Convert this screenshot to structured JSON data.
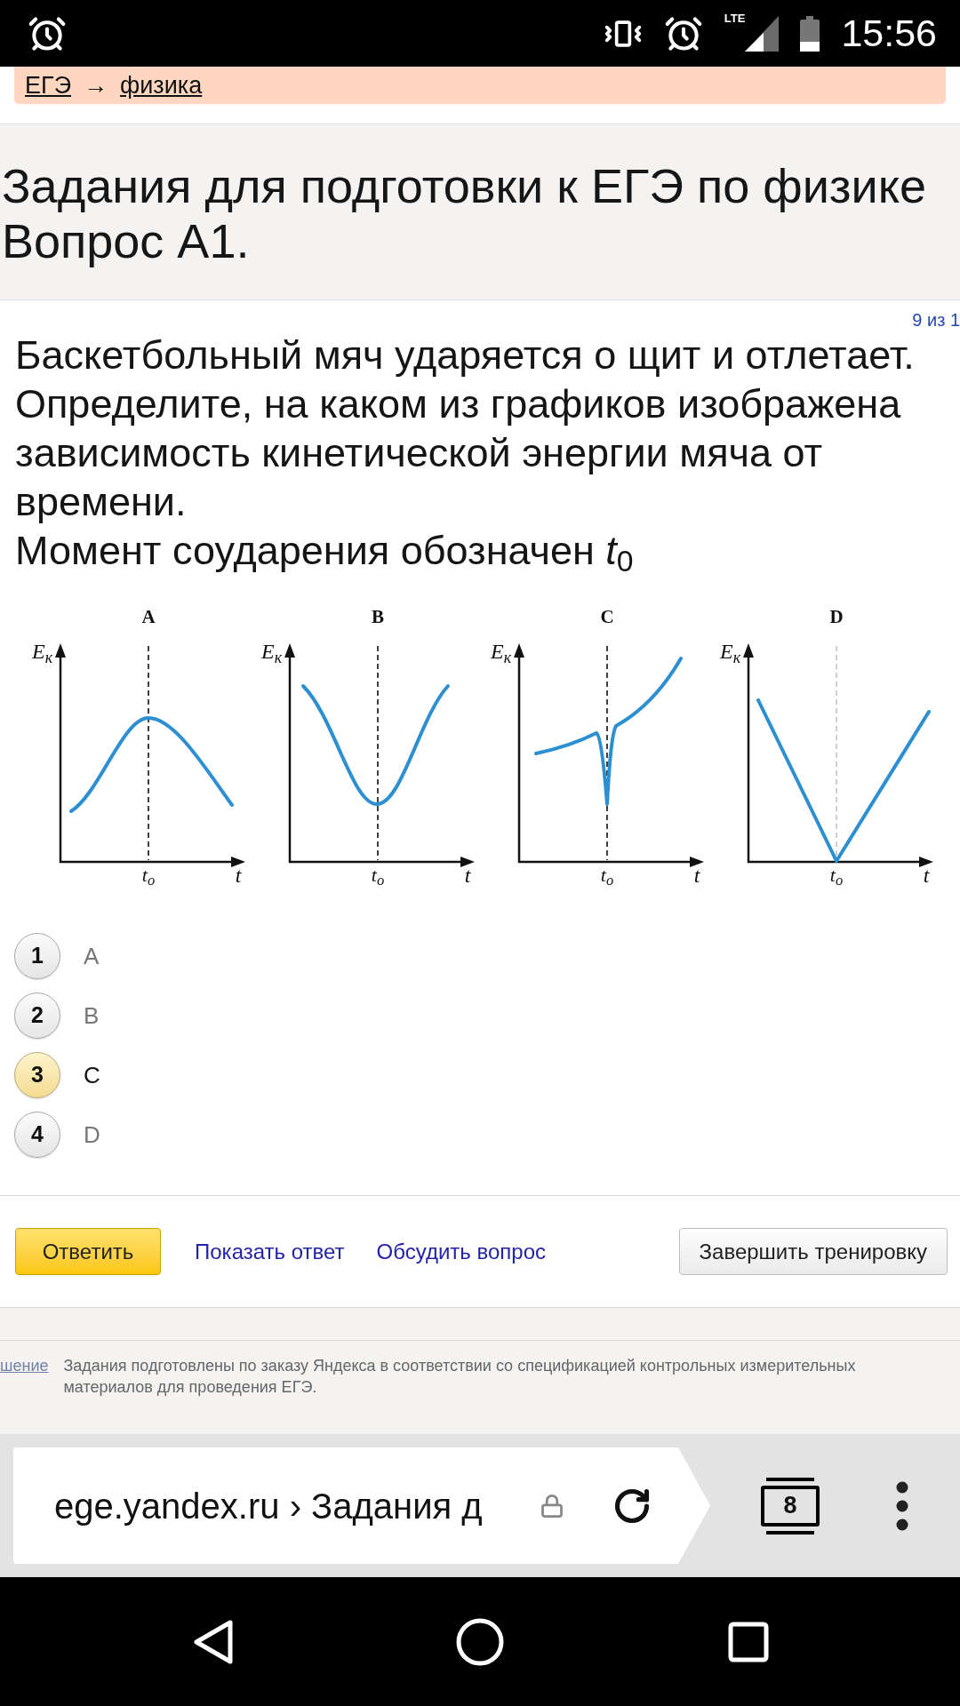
{
  "status_bar": {
    "network": "LTE",
    "time": "15:56"
  },
  "breadcrumbs": {
    "items": [
      "ЕГЭ",
      "физика"
    ],
    "separator": "→"
  },
  "header": {
    "title": "Задания для подготовки к ЕГЭ по физике",
    "question": "Вопрос А1."
  },
  "question": {
    "counter": "9 из 1",
    "text": "Баскетбольный мяч ударяется о щит и отлетает. Определите, на каком из графиков изображена зависимость кинетической энергии мяча от времени.",
    "note": "Момент соударения обозначен *t*$_{0}$"
  },
  "graphs": [
    {
      "label": "A",
      "kind": "peak",
      "y_label": "E$_{к}$",
      "tick_label": "t$_{o}$",
      "x_label": "t"
    },
    {
      "label": "B",
      "kind": "valley",
      "y_label": "E$_{к}$",
      "tick_label": "t$_{o}$",
      "x_label": "t"
    },
    {
      "label": "C",
      "kind": "dip",
      "y_label": "E$_{к}$",
      "tick_label": "t$_{o}$",
      "x_label": "t"
    },
    {
      "label": "D",
      "kind": "v",
      "y_label": "E$_{к}$",
      "tick_label": "t$_{o}$",
      "x_label": "t"
    }
  ],
  "options": [
    {
      "number": "1",
      "label": "A",
      "selected": false
    },
    {
      "number": "2",
      "label": "B",
      "selected": false
    },
    {
      "number": "3",
      "label": "C",
      "selected": true
    },
    {
      "number": "4",
      "label": "D",
      "selected": false
    }
  ],
  "actions": {
    "answer_button": "Ответить",
    "links": [
      "Показать ответ",
      "Обсудить вопрос"
    ],
    "finish_button": "Завершить тренировку"
  },
  "footer": {
    "link": "шение",
    "text": "Задания подготовлены по заказу Яндекса в соответствии со спецификацией контрольных измерительных материалов для проведения ЕГЭ."
  },
  "browser": {
    "url": "ege.yandex.ru › Задания д",
    "tab_count": "8"
  }
}
